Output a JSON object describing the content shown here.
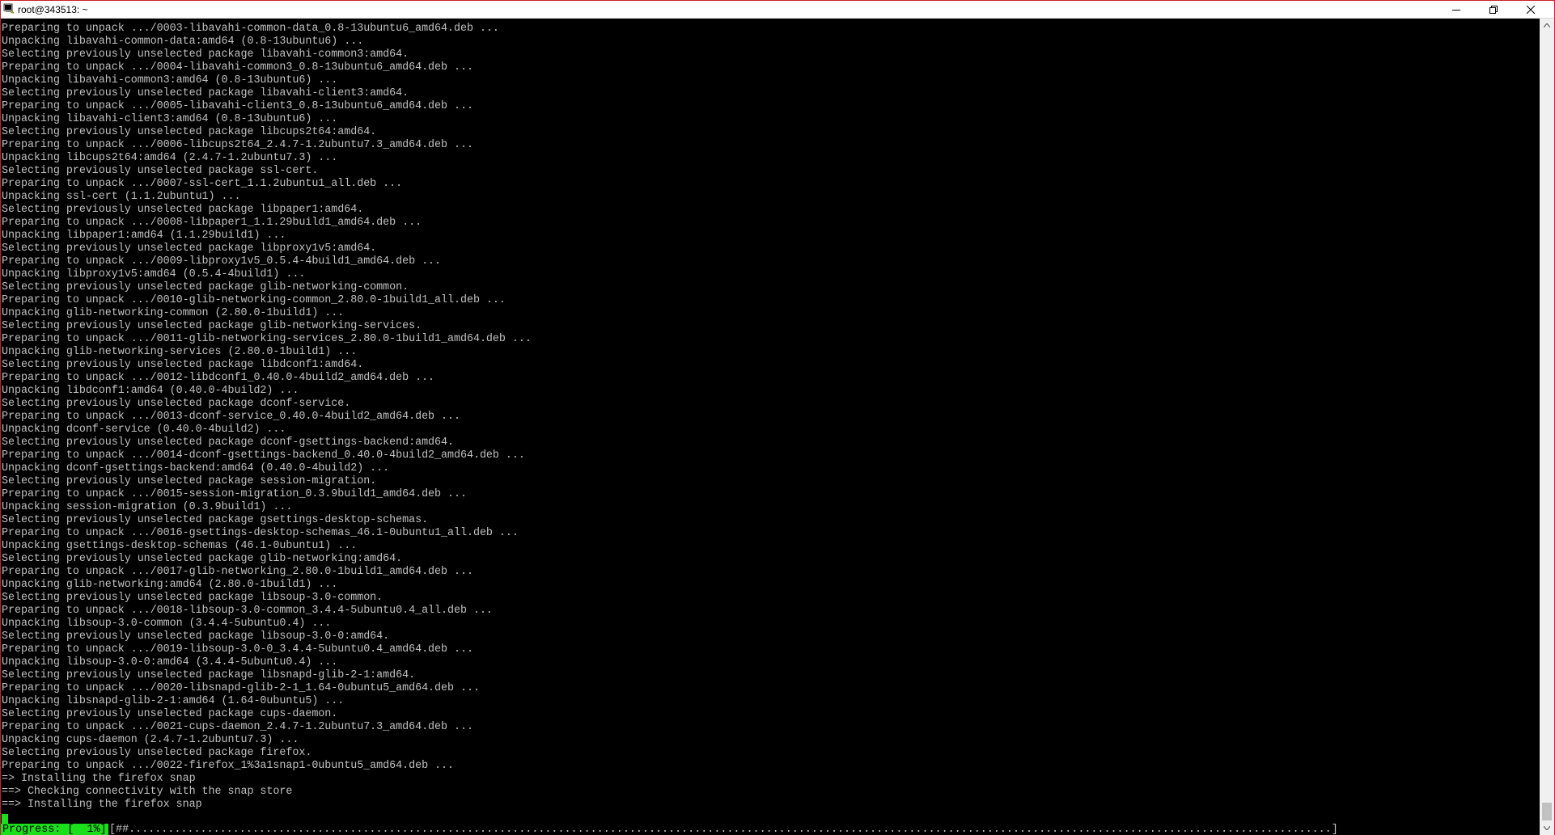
{
  "window": {
    "title": "root@343513: ~",
    "icons": {
      "app": "putty-terminal-icon",
      "minimize": "minimize-icon",
      "restore": "restore-icon",
      "close": "close-icon"
    }
  },
  "terminal": {
    "lines": [
      "Preparing to unpack .../0003-libavahi-common-data_0.8-13ubuntu6_amd64.deb ...",
      "Unpacking libavahi-common-data:amd64 (0.8-13ubuntu6) ...",
      "Selecting previously unselected package libavahi-common3:amd64.",
      "Preparing to unpack .../0004-libavahi-common3_0.8-13ubuntu6_amd64.deb ...",
      "Unpacking libavahi-common3:amd64 (0.8-13ubuntu6) ...",
      "Selecting previously unselected package libavahi-client3:amd64.",
      "Preparing to unpack .../0005-libavahi-client3_0.8-13ubuntu6_amd64.deb ...",
      "Unpacking libavahi-client3:amd64 (0.8-13ubuntu6) ...",
      "Selecting previously unselected package libcups2t64:amd64.",
      "Preparing to unpack .../0006-libcups2t64_2.4.7-1.2ubuntu7.3_amd64.deb ...",
      "Unpacking libcups2t64:amd64 (2.4.7-1.2ubuntu7.3) ...",
      "Selecting previously unselected package ssl-cert.",
      "Preparing to unpack .../0007-ssl-cert_1.1.2ubuntu1_all.deb ...",
      "Unpacking ssl-cert (1.1.2ubuntu1) ...",
      "Selecting previously unselected package libpaper1:amd64.",
      "Preparing to unpack .../0008-libpaper1_1.1.29build1_amd64.deb ...",
      "Unpacking libpaper1:amd64 (1.1.29build1) ...",
      "Selecting previously unselected package libproxy1v5:amd64.",
      "Preparing to unpack .../0009-libproxy1v5_0.5.4-4build1_amd64.deb ...",
      "Unpacking libproxy1v5:amd64 (0.5.4-4build1) ...",
      "Selecting previously unselected package glib-networking-common.",
      "Preparing to unpack .../0010-glib-networking-common_2.80.0-1build1_all.deb ...",
      "Unpacking glib-networking-common (2.80.0-1build1) ...",
      "Selecting previously unselected package glib-networking-services.",
      "Preparing to unpack .../0011-glib-networking-services_2.80.0-1build1_amd64.deb ...",
      "Unpacking glib-networking-services (2.80.0-1build1) ...",
      "Selecting previously unselected package libdconf1:amd64.",
      "Preparing to unpack .../0012-libdconf1_0.40.0-4build2_amd64.deb ...",
      "Unpacking libdconf1:amd64 (0.40.0-4build2) ...",
      "Selecting previously unselected package dconf-service.",
      "Preparing to unpack .../0013-dconf-service_0.40.0-4build2_amd64.deb ...",
      "Unpacking dconf-service (0.40.0-4build2) ...",
      "Selecting previously unselected package dconf-gsettings-backend:amd64.",
      "Preparing to unpack .../0014-dconf-gsettings-backend_0.40.0-4build2_amd64.deb ...",
      "Unpacking dconf-gsettings-backend:amd64 (0.40.0-4build2) ...",
      "Selecting previously unselected package session-migration.",
      "Preparing to unpack .../0015-session-migration_0.3.9build1_amd64.deb ...",
      "Unpacking session-migration (0.3.9build1) ...",
      "Selecting previously unselected package gsettings-desktop-schemas.",
      "Preparing to unpack .../0016-gsettings-desktop-schemas_46.1-0ubuntu1_all.deb ...",
      "Unpacking gsettings-desktop-schemas (46.1-0ubuntu1) ...",
      "Selecting previously unselected package glib-networking:amd64.",
      "Preparing to unpack .../0017-glib-networking_2.80.0-1build1_amd64.deb ...",
      "Unpacking glib-networking:amd64 (2.80.0-1build1) ...",
      "Selecting previously unselected package libsoup-3.0-common.",
      "Preparing to unpack .../0018-libsoup-3.0-common_3.4.4-5ubuntu0.4_all.deb ...",
      "Unpacking libsoup-3.0-common (3.4.4-5ubuntu0.4) ...",
      "Selecting previously unselected package libsoup-3.0-0:amd64.",
      "Preparing to unpack .../0019-libsoup-3.0-0_3.4.4-5ubuntu0.4_amd64.deb ...",
      "Unpacking libsoup-3.0-0:amd64 (3.4.4-5ubuntu0.4) ...",
      "Selecting previously unselected package libsnapd-glib-2-1:amd64.",
      "Preparing to unpack .../0020-libsnapd-glib-2-1_1.64-0ubuntu5_amd64.deb ...",
      "Unpacking libsnapd-glib-2-1:amd64 (1.64-0ubuntu5) ...",
      "Selecting previously unselected package cups-daemon.",
      "Preparing to unpack .../0021-cups-daemon_2.4.7-1.2ubuntu7.3_amd64.deb ...",
      "Unpacking cups-daemon (2.4.7-1.2ubuntu7.3) ...",
      "Selecting previously unselected package firefox.",
      "Preparing to unpack .../0022-firefox_1%3a1snap1-0ubuntu5_amd64.deb ...",
      "=> Installing the firefox snap",
      "==> Checking connectivity with the snap store",
      "==> Installing the firefox snap"
    ],
    "progress": {
      "label": "Progress: [  1%]",
      "bar": "[##.........................................................................................................................................................................................]",
      "percent": 1
    }
  },
  "scrollbar": {
    "icons": {
      "up": "scroll-up-arrow-icon",
      "down": "scroll-down-arrow-icon"
    }
  }
}
